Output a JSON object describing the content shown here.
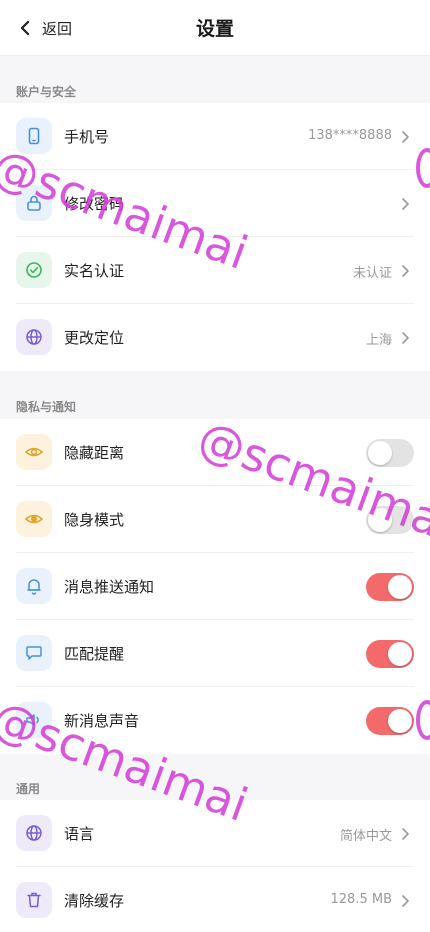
{
  "header": {
    "back_label": "返回",
    "title": "设置"
  },
  "sections": {
    "account": {
      "title": "账户与安全",
      "items": [
        {
          "label": "手机号",
          "value": "138****8888",
          "icon": "phone-icon"
        },
        {
          "label": "修改密码",
          "value": "",
          "icon": "lock-icon"
        },
        {
          "label": "实名认证",
          "value": "未认证",
          "icon": "check-circle-icon"
        },
        {
          "label": "更改定位",
          "value": "上海",
          "icon": "globe-icon"
        }
      ]
    },
    "privacy": {
      "title": "隐私与通知",
      "items": [
        {
          "label": "隐藏距离",
          "on": false,
          "icon": "eye-icon"
        },
        {
          "label": "隐身模式",
          "on": false,
          "icon": "eye-filled-icon"
        },
        {
          "label": "消息推送通知",
          "on": true,
          "icon": "bell-icon"
        },
        {
          "label": "匹配提醒",
          "on": true,
          "icon": "chat-bubble-icon"
        },
        {
          "label": "新消息声音",
          "on": true,
          "icon": "speaker-icon"
        }
      ]
    },
    "general": {
      "title": "通用",
      "items": [
        {
          "label": "语言",
          "value": "简体中文",
          "icon": "globe-icon"
        },
        {
          "label": "清除缓存",
          "value": "128.5 MB",
          "icon": "trash-icon"
        }
      ]
    }
  },
  "watermark": "@scmaimai",
  "colors": {
    "toggle_on": "#f46a6b",
    "toggle_off": "#e3e3e3",
    "icon_blue_bg": "#e8f1fc",
    "icon_green_bg": "#e6f6ea",
    "icon_purple_bg": "#efeafa",
    "icon_yellow_bg": "#fdf2dd"
  }
}
